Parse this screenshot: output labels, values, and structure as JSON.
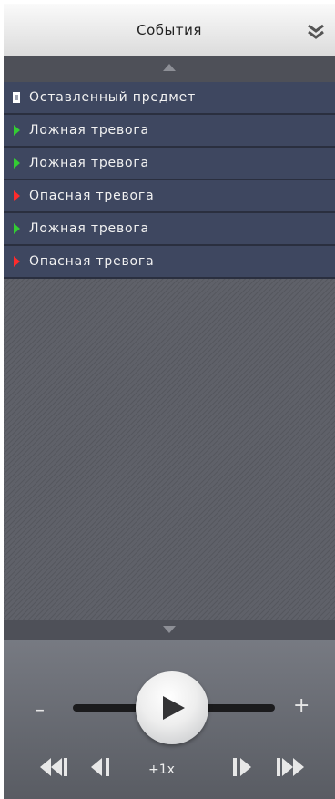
{
  "header": {
    "title": "События",
    "collapse_icon": "double-chevron-down-icon"
  },
  "scroll": {
    "up_icon": "arrow-up-icon",
    "down_icon": "arrow-down-icon"
  },
  "events": [
    {
      "label": "Оставленный предмет",
      "marker": "document-icon",
      "color": "#ffffff"
    },
    {
      "label": "Ложная тревога",
      "marker": "triangle-right-icon",
      "color": "#33cc33"
    },
    {
      "label": "Ложная тревога",
      "marker": "triangle-right-icon",
      "color": "#33cc33"
    },
    {
      "label": "Опасная тревога",
      "marker": "triangle-right-icon",
      "color": "#ff2b2b"
    },
    {
      "label": "Ложная тревога",
      "marker": "triangle-right-icon",
      "color": "#33cc33"
    },
    {
      "label": "Опасная тревога",
      "marker": "triangle-right-icon",
      "color": "#ff2b2b"
    }
  ],
  "player": {
    "zoom_out_label": "–",
    "zoom_in_label": "+",
    "speed_label": "+1x",
    "controls": {
      "fast_rewind_icon": "fast-rewind-icon",
      "step_back_icon": "step-back-icon",
      "step_forward_icon": "step-forward-icon",
      "fast_forward_icon": "fast-forward-icon",
      "play_icon": "play-icon"
    }
  }
}
